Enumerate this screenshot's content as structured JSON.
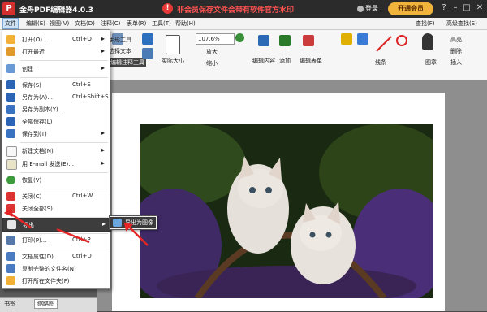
{
  "window": {
    "app_title": "金舟PDF编辑器4.0.3",
    "warning_text": "非会员保存文件会带有软件官方水印",
    "login_label": "登录",
    "member_label": "开通会员",
    "help_icon": "question-icon",
    "min_icon": "minimize-icon",
    "max_icon": "maximize-icon",
    "close_icon": "close-icon"
  },
  "menubar": {
    "items": [
      "文件",
      "编辑(E)",
      "视图(V)",
      "文档(D)",
      "注释(C)",
      "表单(R)",
      "工具(T)",
      "帮助(H)"
    ],
    "right_items": [
      "查找(F)",
      "高级查找(S)"
    ]
  },
  "ribbon": {
    "tools": [
      "手形工具",
      "选择文本",
      "编辑注释工具",
      "实际大小",
      "放大",
      "缩小",
      "编辑内容",
      "添加",
      "编辑表单",
      "线条",
      "图章",
      "高亮",
      "删除",
      "插入"
    ],
    "zoom_value": "107.6%"
  },
  "file_menu": {
    "items": [
      {
        "label": "打开(O)...",
        "shortcut": "Ctrl+O",
        "submenu": true
      },
      {
        "label": "打开最近",
        "shortcut": "",
        "submenu": true
      },
      {
        "label": "创建",
        "shortcut": "",
        "submenu": true
      },
      {
        "label": "保存(S)",
        "shortcut": "Ctrl+S",
        "submenu": false
      },
      {
        "label": "另存为(A)...",
        "shortcut": "Ctrl+Shift+S",
        "submenu": false
      },
      {
        "label": "另存为副本(Y)...",
        "shortcut": "",
        "submenu": false
      },
      {
        "label": "全部保存(L)",
        "shortcut": "",
        "submenu": false
      },
      {
        "label": "保存到(T)",
        "shortcut": "",
        "submenu": true
      },
      {
        "label": "新建文档(N)",
        "shortcut": "",
        "submenu": true
      },
      {
        "label": "用 E-mail 发送(E)...",
        "shortcut": "",
        "submenu": true
      },
      {
        "label": "恢复(V)",
        "shortcut": "",
        "submenu": false
      },
      {
        "label": "关闭(C)",
        "shortcut": "Ctrl+W",
        "submenu": false
      },
      {
        "label": "关闭全部(S)",
        "shortcut": "",
        "submenu": false
      },
      {
        "label": "导出",
        "shortcut": "",
        "submenu": true
      },
      {
        "label": "打印(P)...",
        "shortcut": "Ctrl+P",
        "submenu": false
      },
      {
        "label": "文档属性(D)...",
        "shortcut": "Ctrl+D",
        "submenu": false
      },
      {
        "label": "复制完整的文件名(N)",
        "shortcut": "",
        "submenu": false
      },
      {
        "label": "打开所在文件夹(F)",
        "shortcut": "",
        "submenu": false
      }
    ]
  },
  "export_submenu": {
    "item_label": "导出为图像"
  },
  "bottom_tabs": [
    "书签",
    "缩略图"
  ]
}
